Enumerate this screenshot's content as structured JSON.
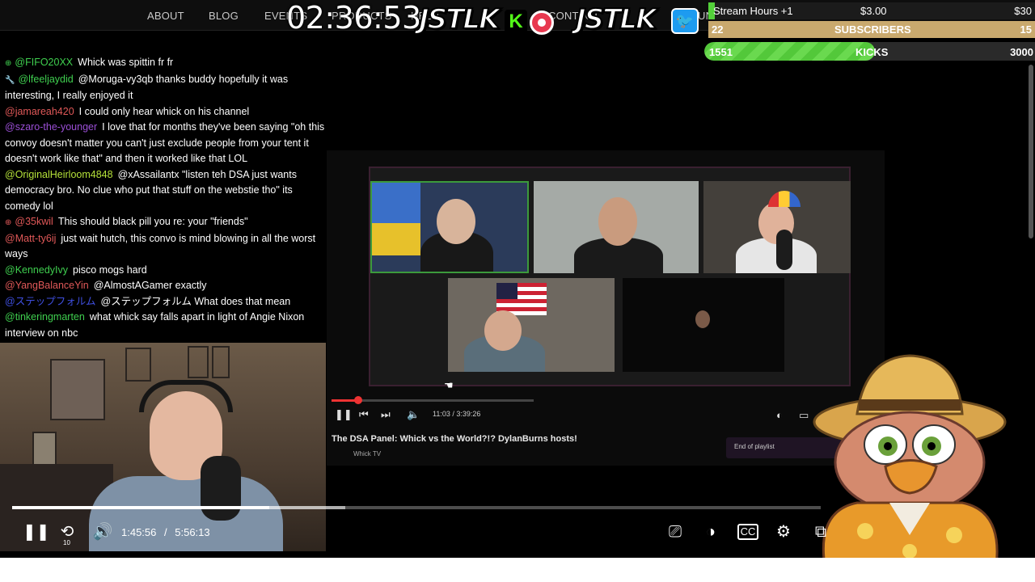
{
  "nav": {
    "items": [
      "ABOUT",
      "BLOG",
      "EVENTS",
      "PRODUCTS",
      "HELP",
      "CONTACT",
      "UN"
    ]
  },
  "overlay": {
    "timer": "02:36:53",
    "logo_left": "JSTLK",
    "logo_right": "JSTLK",
    "kick_letter": "K",
    "twitter_glyph": "🐦",
    "bars": {
      "hours": {
        "label": "Stream Hours +1",
        "amount": "$3.00",
        "goal": "$30",
        "progress": 0.02
      },
      "subs": {
        "current": "22",
        "label": "SUBSCRIBERS",
        "goal": "15"
      },
      "kicks": {
        "current": "1551",
        "label": "KICKS",
        "goal": "3000",
        "progress": 0.517
      }
    }
  },
  "chat": [
    {
      "badge": "⊕",
      "user": "@FIFO20XX",
      "user_color": "#3fcf4f",
      "text": "Whick was spittin fr fr"
    },
    {
      "badge": "🔧",
      "user": "@lfeeljaydid",
      "user_color": "#3fcf4f",
      "text": "@Moruga-vy3qb thanks buddy hopefully it was interesting, I really enjoyed it"
    },
    {
      "badge": "",
      "user": "@jamareah420",
      "user_color": "#e05858",
      "text": "I could only hear whick on his channel"
    },
    {
      "badge": "",
      "user": "@szaro-the-younger",
      "user_color": "#9b4fd6",
      "text": "I love that for months they've been saying \"oh this convoy doesn't matter you can't just exclude people from your tent it doesn't work like that\" and then it worked like that LOL"
    },
    {
      "badge": "",
      "user": "@OriginalHeirloom4848",
      "user_color": "#b6e33a",
      "text": "@xAssailantx \"listen teh DSA just wants democracy bro. No clue who put that stuff on the webstie tho\" its comedy lol"
    },
    {
      "badge": "⊕",
      "user": "@35kwil",
      "user_color": "#e05858",
      "text": "This should black pill you re: your \"friends\""
    },
    {
      "badge": "",
      "user": "@Matt-ty6ij",
      "user_color": "#e05858",
      "text": "just wait hutch, this convo is mind blowing in all the worst ways"
    },
    {
      "badge": "",
      "user": "@KennedyIvy",
      "user_color": "#3fcf4f",
      "text": "pisco mogs hard"
    },
    {
      "badge": "",
      "user": "@YangBalanceYin",
      "user_color": "#e05858",
      "text": "@AlmostAGamer exactly"
    },
    {
      "badge": "",
      "user": "@ステップフォルム",
      "user_color": "#3f4fe0",
      "text": "@ステップフォルム What does that mean"
    },
    {
      "badge": "",
      "user": "@tinkeringmarten",
      "user_color": "#3fcf4f",
      "text": "what whick say falls apart in light of Angie Nixon interview on nbc"
    }
  ],
  "embed": {
    "time": "11:03 / 3:39:26",
    "title": "The DSA Panel: Whick vs the World?!? DylanBurns hosts!",
    "channel": "Whick TV",
    "playlist_label": "End of playlist",
    "progress": 0.13
  },
  "player": {
    "current": "1:45:56",
    "separator": "/",
    "duration": "5:56:13",
    "played": 0.318,
    "buffered": 0.412,
    "rewind_label": "10",
    "icons": {
      "pause": "pause-icon",
      "rewind": "rewind-10-icon",
      "volume": "volume-icon",
      "airplay": "airplay-icon",
      "contrast": "contrast-icon",
      "cc": "closed-captions-icon",
      "settings": "gear-icon",
      "pip": "picture-in-picture-icon"
    }
  },
  "colors": {
    "kick_green": "#53fc18",
    "subs_gold": "#c9a96e",
    "twitter_blue": "#1d9bf0",
    "rec_red": "#e8384f"
  }
}
